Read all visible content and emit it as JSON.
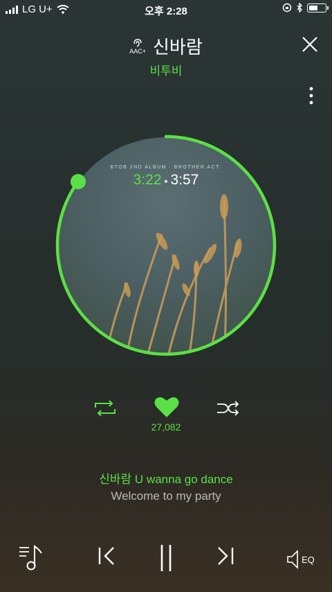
{
  "status": {
    "carrier": "LG U+",
    "time": "오후 2:28"
  },
  "header": {
    "quality_badge": "AAC+",
    "title": "신바람",
    "artist": "비투비"
  },
  "album": {
    "caption": "BTOB 2ND ALBUM · BROTHER ACT.",
    "current_time": "3:22",
    "separator": "•",
    "total_time": "3:57",
    "progress": 0.85
  },
  "actions": {
    "like_count": "27,082"
  },
  "lyrics": {
    "current": "신바람 U wanna go dance",
    "next": "Welcome to my party"
  },
  "controls": {
    "eq_label": "EQ"
  },
  "colors": {
    "accent": "#5be046"
  }
}
